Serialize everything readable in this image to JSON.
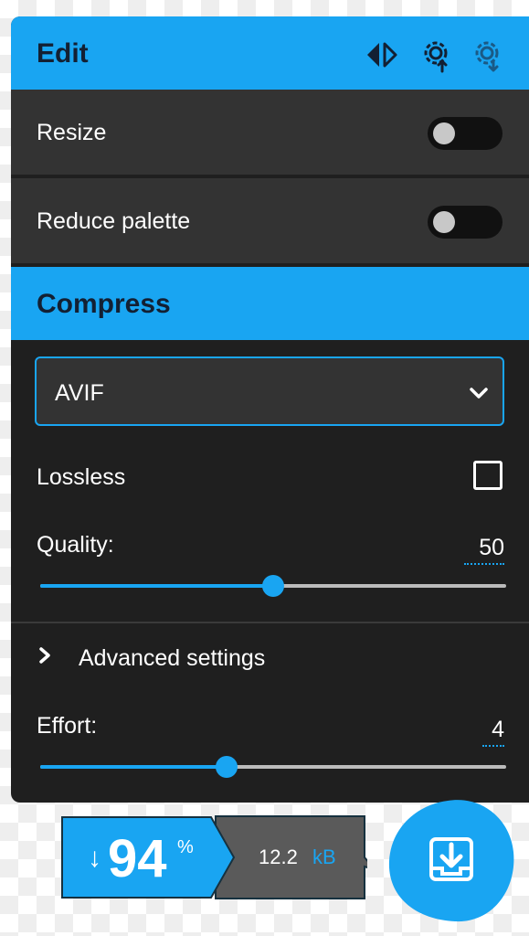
{
  "edit": {
    "title": "Edit",
    "icons": [
      "compare-arrows-icon",
      "import-settings-icon",
      "export-settings-icon"
    ],
    "resize": {
      "label": "Resize",
      "enabled": false
    },
    "reduce_palette": {
      "label": "Reduce palette",
      "enabled": false
    }
  },
  "compress": {
    "title": "Compress",
    "format": {
      "selected": "AVIF"
    },
    "lossless": {
      "label": "Lossless",
      "checked": false
    },
    "quality": {
      "label": "Quality:",
      "value": "50",
      "fraction": 0.5
    },
    "advanced": {
      "label": "Advanced settings",
      "expanded": false
    },
    "effort": {
      "label": "Effort:",
      "value": "4",
      "fraction": 0.4
    }
  },
  "result": {
    "arrow": "↓",
    "percent": "94",
    "percent_sign": "%",
    "size": "12.2",
    "unit": "kB"
  },
  "download": {
    "icon": "download-icon"
  },
  "colors": {
    "accent": "#19a5f2",
    "panel_bg": "#1f1f1f",
    "row_bg": "#333333",
    "header_text": "#132033"
  }
}
